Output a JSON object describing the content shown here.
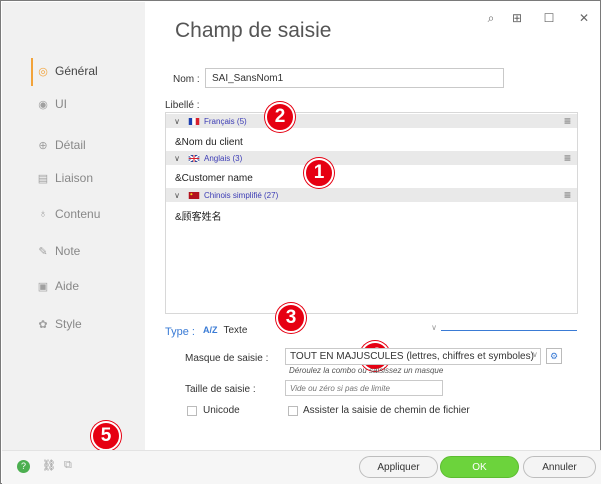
{
  "window": {
    "title": "Champ de saisie",
    "controls": [
      "⌕",
      "⊞",
      "☐",
      "✕"
    ]
  },
  "sidebar": {
    "items": [
      {
        "label": "Général",
        "icon": "general-icon",
        "glyph": "◎",
        "active": true
      },
      {
        "label": "UI",
        "icon": "eye-icon",
        "glyph": "◉"
      },
      {
        "label": "Détail",
        "icon": "detail-icon",
        "glyph": "⊕"
      },
      {
        "label": "Liaison",
        "icon": "link-icon",
        "glyph": "▤"
      },
      {
        "label": "Contenu",
        "icon": "content-icon",
        "glyph": "♁"
      },
      {
        "label": "Note",
        "icon": "pencil-icon",
        "glyph": "✎"
      },
      {
        "label": "Aide",
        "icon": "help-icon",
        "glyph": "▣"
      },
      {
        "label": "Style",
        "icon": "style-icon",
        "glyph": "✿"
      }
    ],
    "accent": "#f2a33a"
  },
  "form": {
    "nom_label": "Nom :",
    "nom_value": "SAI_SansNom1",
    "libelle_label": "Libellé :",
    "languages": [
      {
        "name": "Français (5)",
        "text": "&Nom du client"
      },
      {
        "name": "Anglais (3)",
        "text": "&Customer name"
      },
      {
        "name": "Chinois simplifié (27)",
        "text": "&顾客姓名"
      }
    ],
    "type_label": "Type :",
    "type_value": "Texte",
    "type_icon": "A/Z",
    "masque_label": "Masque de saisie :",
    "masque_value": "TOUT EN MAJUSCULES (lettres, chiffres et symboles)",
    "masque_hint": "Déroulez la combo ou saisissez un masque",
    "taille_label": "Taille de saisie :",
    "taille_placeholder": "Vide ou zéro si pas de limite",
    "unicode_label": "Unicode",
    "assister_label": "Assister la saisie de chemin de fichier"
  },
  "badges": [
    "2",
    "1",
    "3",
    "4",
    "5"
  ],
  "buttons": {
    "apply": "Appliquer",
    "ok": "OK",
    "cancel": "Annuler"
  },
  "colors": {
    "ok_button": "#6cd33c",
    "badge": "#e60012",
    "type_accent": "#3a7bd5"
  }
}
